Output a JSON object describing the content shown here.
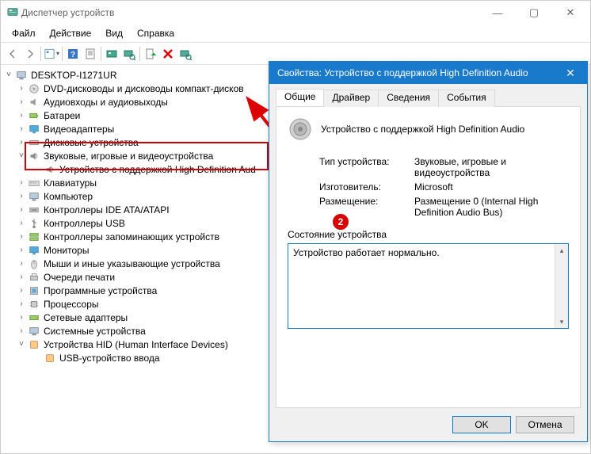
{
  "main_window": {
    "title": "Диспетчер устройств",
    "menu": {
      "file": "Файл",
      "action": "Действие",
      "view": "Вид",
      "help": "Справка"
    },
    "wincontrols": {
      "min": "—",
      "max": "▢",
      "close": "✕"
    }
  },
  "tree": {
    "root": "DESKTOP-I1271UR",
    "items": [
      {
        "label": "DVD-дисководы и дисководы компакт-дисков",
        "icon": "disc"
      },
      {
        "label": "Аудиовходы и аудиовыходы",
        "icon": "audio"
      },
      {
        "label": "Батареи",
        "icon": "battery"
      },
      {
        "label": "Видеоадаптеры",
        "icon": "display"
      },
      {
        "label": "Дисковые устройства",
        "icon": "drive"
      },
      {
        "label": "Звуковые, игровые и видеоустройства",
        "icon": "speaker",
        "expanded": true,
        "children": [
          {
            "label": "Устройство с поддержкой High Definition Aud",
            "icon": "speaker"
          }
        ]
      },
      {
        "label": "Клавиатуры",
        "icon": "keyboard"
      },
      {
        "label": "Компьютер",
        "icon": "pc"
      },
      {
        "label": "Контроллеры IDE ATA/ATAPI",
        "icon": "ide"
      },
      {
        "label": "Контроллеры USB",
        "icon": "usb"
      },
      {
        "label": "Контроллеры запоминающих устройств",
        "icon": "storage"
      },
      {
        "label": "Мониторы",
        "icon": "monitor"
      },
      {
        "label": "Мыши и иные указывающие устройства",
        "icon": "mouse"
      },
      {
        "label": "Очереди печати",
        "icon": "printer"
      },
      {
        "label": "Программные устройства",
        "icon": "software"
      },
      {
        "label": "Процессоры",
        "icon": "cpu"
      },
      {
        "label": "Сетевые адаптеры",
        "icon": "network"
      },
      {
        "label": "Системные устройства",
        "icon": "system"
      },
      {
        "label": "Устройства HID (Human Interface Devices)",
        "icon": "hid",
        "expanded": true,
        "children": [
          {
            "label": "USB-устройство ввода",
            "icon": "hid"
          }
        ]
      }
    ]
  },
  "dialog": {
    "title": "Свойства: Устройство с поддержкой High Definition Audio",
    "close": "✕",
    "tabs": {
      "general": "Общие",
      "driver": "Драйвер",
      "details": "Сведения",
      "events": "События"
    },
    "device_name": "Устройство с поддержкой High Definition Audio",
    "props": {
      "type_k": "Тип устройства:",
      "type_v": "Звуковые, игровые и видеоустройства",
      "mfr_k": "Изготовитель:",
      "mfr_v": "Microsoft",
      "loc_k": "Размещение:",
      "loc_v": "Размещение 0 (Internal High Definition Audio Bus)"
    },
    "status_label": "Состояние устройства",
    "status_text": "Устройство работает нормально.",
    "ok": "OK",
    "cancel": "Отмена"
  },
  "annotation": {
    "badge2": "2"
  }
}
